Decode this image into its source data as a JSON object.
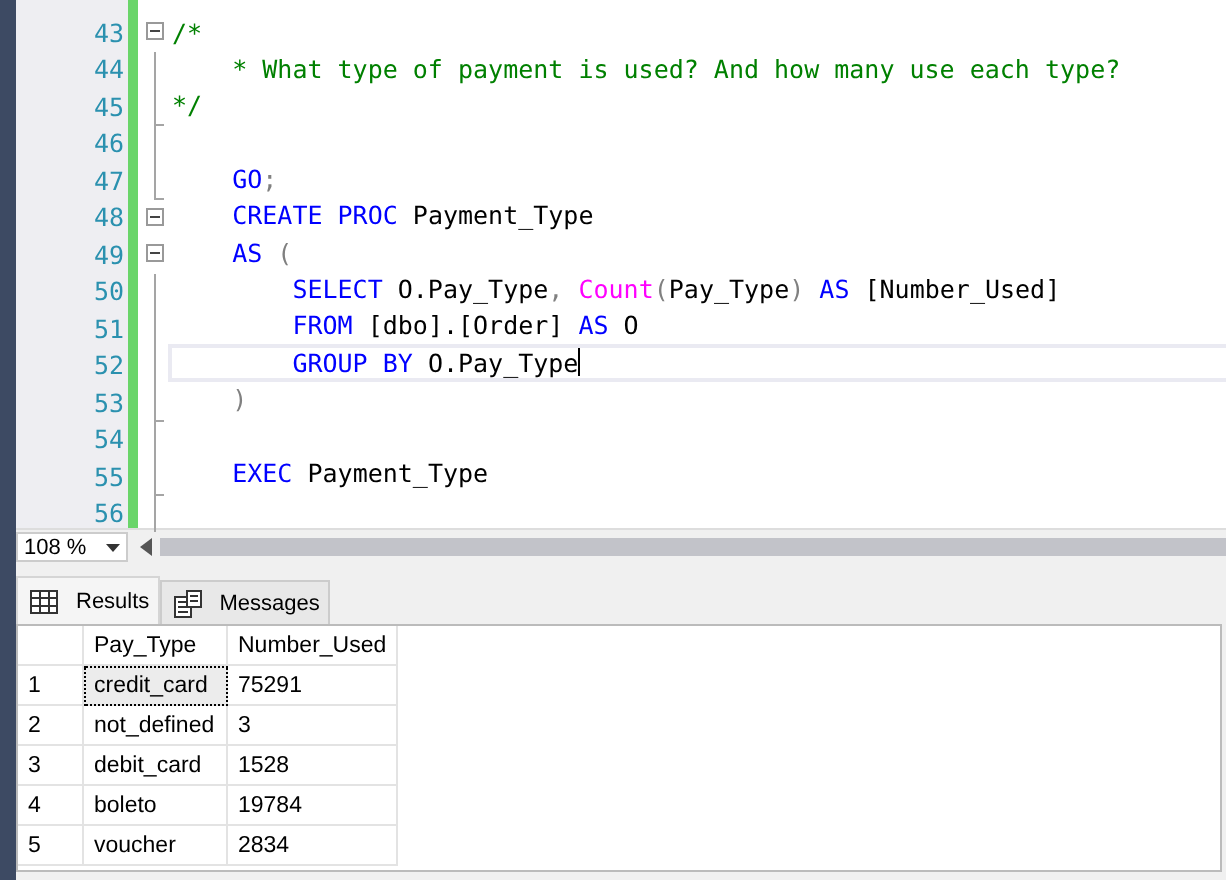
{
  "editor": {
    "lines": [
      {
        "number": "43",
        "collapsible": true,
        "block_end": false,
        "current": false,
        "tokens": [
          {
            "kind": "comment",
            "text": "/*"
          }
        ]
      },
      {
        "number": "44",
        "collapsible": false,
        "block_end": false,
        "current": false,
        "tokens": [
          {
            "kind": "comment",
            "text": "    * What type of payment is used? And how many use each type?"
          }
        ]
      },
      {
        "number": "45",
        "collapsible": false,
        "block_end": true,
        "current": false,
        "tokens": [
          {
            "kind": "comment",
            "text": "*/"
          }
        ]
      },
      {
        "number": "46",
        "collapsible": false,
        "block_end": false,
        "current": false
      },
      {
        "number": "47",
        "collapsible": false,
        "block_end": true,
        "current": false,
        "tokens": [
          {
            "kind": "keyword",
            "text": "    GO"
          },
          {
            "kind": "punct",
            "text": ";"
          }
        ]
      },
      {
        "number": "48",
        "collapsible": true,
        "block_end": false,
        "current": false,
        "tokens": [
          {
            "kind": "keyword",
            "text": "    CREATE PROC"
          },
          {
            "kind": "plain",
            "text": " Payment_Type"
          }
        ]
      },
      {
        "number": "49",
        "collapsible": true,
        "block_end": false,
        "current": false,
        "tokens": [
          {
            "kind": "keyword",
            "text": "    AS"
          },
          {
            "kind": "punct",
            "text": " ("
          }
        ]
      },
      {
        "number": "50",
        "collapsible": false,
        "block_end": false,
        "current": false,
        "tokens": [
          {
            "kind": "keyword",
            "text": "        SELECT"
          },
          {
            "kind": "plain",
            "text": " O.Pay_Type"
          },
          {
            "kind": "punct",
            "text": ", "
          },
          {
            "kind": "function",
            "text": "Count"
          },
          {
            "kind": "punct",
            "text": "("
          },
          {
            "kind": "plain",
            "text": "Pay_Type"
          },
          {
            "kind": "punct",
            "text": ") "
          },
          {
            "kind": "keyword",
            "text": "AS"
          },
          {
            "kind": "plain",
            "text": " [Number_Used]"
          }
        ]
      },
      {
        "number": "51",
        "collapsible": false,
        "block_end": false,
        "current": false,
        "tokens": [
          {
            "kind": "keyword",
            "text": "        FROM"
          },
          {
            "kind": "plain",
            "text": " [dbo].[Order] "
          },
          {
            "kind": "keyword",
            "text": "AS"
          },
          {
            "kind": "plain",
            "text": " O"
          }
        ]
      },
      {
        "number": "52",
        "collapsible": false,
        "block_end": false,
        "current": true,
        "tokens": [
          {
            "kind": "keyword",
            "text": "        GROUP BY"
          },
          {
            "kind": "plain",
            "text": " O.Pay_Type"
          }
        ]
      },
      {
        "number": "53",
        "collapsible": false,
        "block_end": true,
        "current": false,
        "tokens": [
          {
            "kind": "punct",
            "text": "    )"
          }
        ]
      },
      {
        "number": "54",
        "collapsible": false,
        "block_end": false,
        "current": false
      },
      {
        "number": "55",
        "collapsible": false,
        "block_end": true,
        "current": false,
        "tokens": [
          {
            "kind": "keyword",
            "text": "    EXEC"
          },
          {
            "kind": "plain",
            "text": " Payment_Type"
          }
        ]
      },
      {
        "number": "56",
        "collapsible": false,
        "block_end": false,
        "current": false
      }
    ]
  },
  "zoom": {
    "value": "108 %"
  },
  "tabs": [
    {
      "label": "Results",
      "selected": true
    },
    {
      "label": "Messages",
      "selected": false
    }
  ],
  "results": {
    "columns": [
      "Pay_Type",
      "Number_Used"
    ],
    "rows": [
      {
        "number": "1",
        "cells": [
          "credit_card",
          "75291"
        ],
        "selected": true
      },
      {
        "number": "2",
        "cells": [
          "not_defined",
          "3"
        ],
        "selected": false
      },
      {
        "number": "3",
        "cells": [
          "debit_card",
          "1528"
        ],
        "selected": false
      },
      {
        "number": "4",
        "cells": [
          "boleto",
          "19784"
        ],
        "selected": false
      },
      {
        "number": "5",
        "cells": [
          "voucher",
          "2834"
        ],
        "selected": false
      }
    ]
  }
}
